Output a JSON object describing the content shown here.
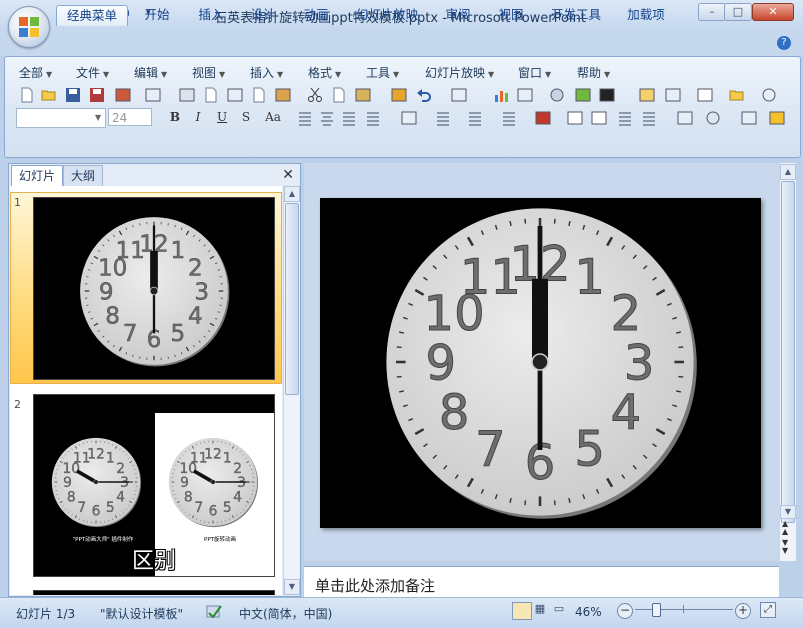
{
  "window": {
    "title": "石英表指针旋转动画ppt特效模板.pptx - Microsoft PowerPoint",
    "controls": {
      "minimize": "–",
      "maximize": "□",
      "close": "✕"
    }
  },
  "ribbon": {
    "tabs": [
      "经典菜单",
      "开始",
      "插入",
      "设计",
      "动画",
      "幻灯片放映",
      "审阅",
      "视图",
      "开发工具",
      "加载项"
    ],
    "active_tab": "经典菜单",
    "menus": [
      "全部",
      "文件",
      "编辑",
      "视图",
      "插入",
      "格式",
      "工具",
      "幻灯片放映",
      "窗口",
      "帮助"
    ],
    "font_size": "24",
    "format_buttons": [
      "B",
      "I",
      "U",
      "S",
      "Aa"
    ]
  },
  "left_pane": {
    "tabs": [
      "幻灯片",
      "大纲"
    ],
    "close": "✕",
    "slides": [
      {
        "number": "1"
      },
      {
        "number": "2",
        "caption_left": "\"PPT动画大师\" 插件制作",
        "caption_right": "PPT旋转动画",
        "overlay_text": "区别"
      }
    ]
  },
  "clock": {
    "numbers": [
      "12",
      "1",
      "2",
      "3",
      "4",
      "5",
      "6",
      "7",
      "8",
      "9",
      "10",
      "11"
    ]
  },
  "notes": {
    "placeholder": "单击此处添加备注"
  },
  "status": {
    "slide": "幻灯片 1/3",
    "theme": "\"默认设计模板\"",
    "language": "中文(简体，中国)",
    "zoom": "46%",
    "zoom_level": 0.46
  },
  "colors": {
    "ribbon_text": "#15428b",
    "selection": "#ffc54a"
  }
}
